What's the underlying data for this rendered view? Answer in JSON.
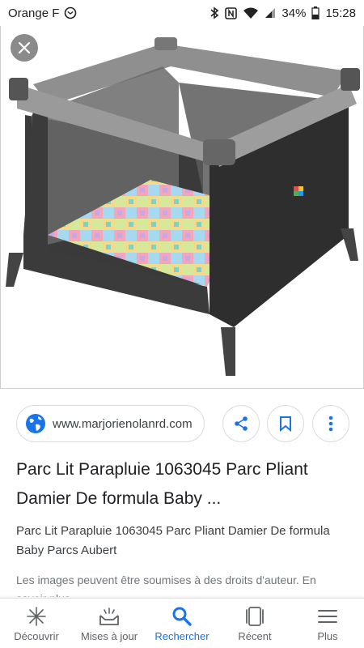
{
  "status_bar": {
    "carrier": "Orange F",
    "battery": "34%",
    "time": "15:28"
  },
  "image": {
    "description_icon": "playpen-photo"
  },
  "source": {
    "url": "www.marjorienolanrd.com",
    "share_icon": "share-icon",
    "bookmark_icon": "bookmark-icon",
    "more_icon": "more-vert-icon"
  },
  "result": {
    "title": "Parc Lit Parapluie 1063045 Parc Pliant Damier De formula Baby ...",
    "subtitle": "Parc Lit Parapluie 1063045 Parc Pliant Damier De formula Baby Parcs Aubert",
    "copyright": "Les images peuvent être soumises à des droits d'auteur. En savoir plus"
  },
  "nav": {
    "items": [
      {
        "label": "Découvrir",
        "icon": "discover-icon"
      },
      {
        "label": "Mises à jour",
        "icon": "updates-icon"
      },
      {
        "label": "Rechercher",
        "icon": "search-icon"
      },
      {
        "label": "Récent",
        "icon": "recent-icon"
      },
      {
        "label": "Plus",
        "icon": "menu-icon"
      }
    ],
    "active_color": "#1a73e8"
  },
  "colors": {
    "accent": "#1a73e8",
    "globe": "#1a73e8"
  }
}
